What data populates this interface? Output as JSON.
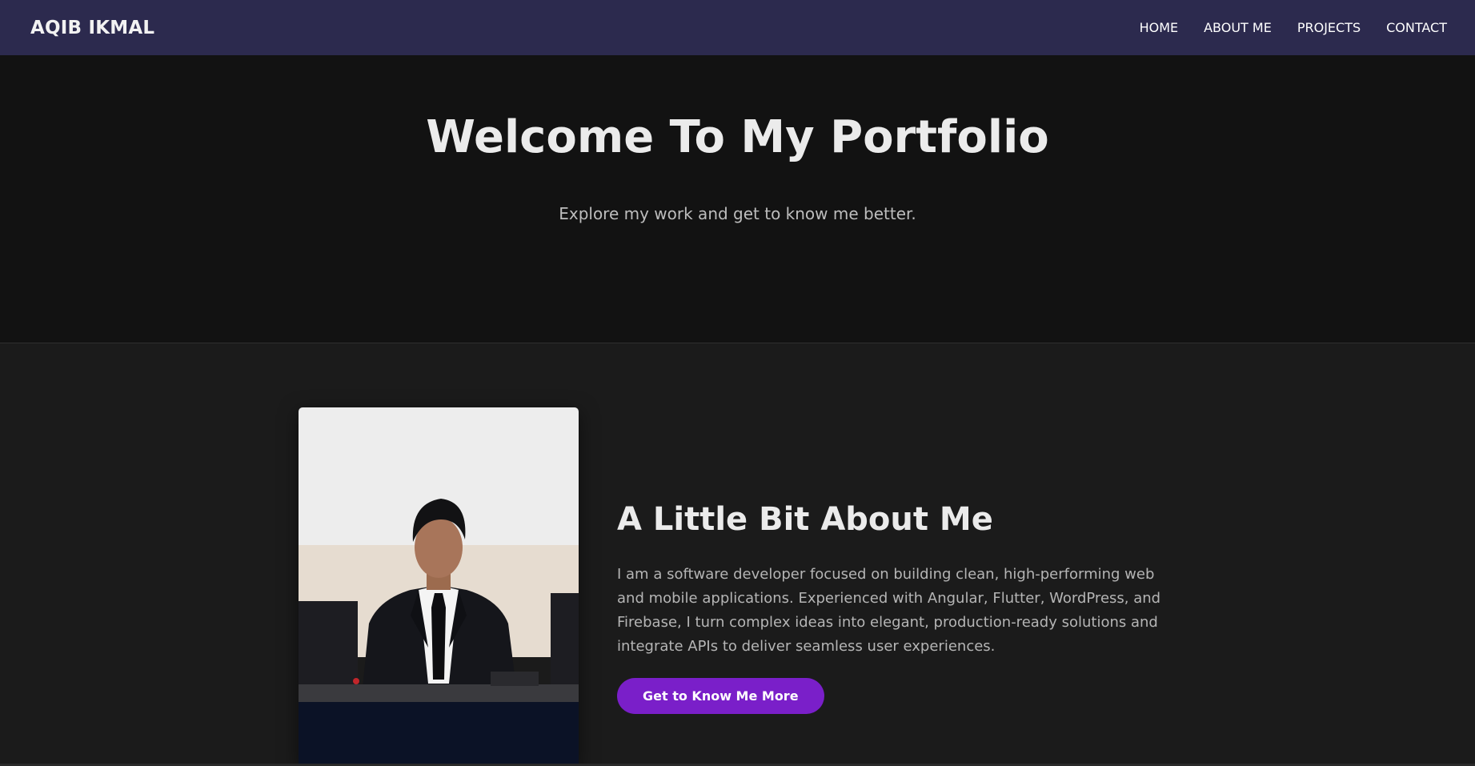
{
  "navbar": {
    "brand": "AQIB IKMAL",
    "links": [
      "HOME",
      "ABOUT ME",
      "PROJECTS",
      "CONTACT"
    ]
  },
  "hero": {
    "title": "Welcome To My Portfolio",
    "subtitle": "Explore my work and get to know me better."
  },
  "about": {
    "heading": "A Little Bit About Me",
    "body": "I am a software developer focused on building clean, high-performing web and mobile applications. Experienced with Angular, Flutter, WordPress, and Firebase, I turn complex ideas into elegant, production-ready solutions and integrate APIs to deliver seamless user experiences.",
    "button_label": "Get to Know Me More"
  },
  "colors": {
    "navbar_bg": "#2c2a4e",
    "hero_bg": "#121212",
    "section_bg": "#1b1b1b",
    "accent": "#7a1fc9"
  }
}
